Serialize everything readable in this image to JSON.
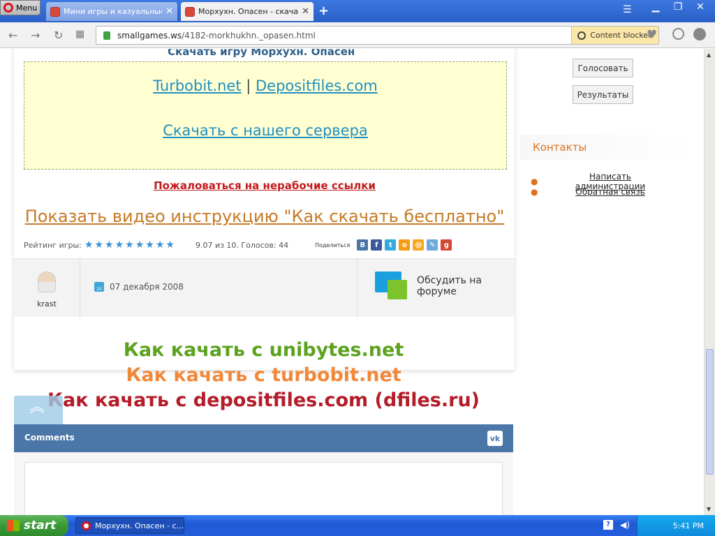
{
  "browser": {
    "menu_label": "Menu",
    "tabs": [
      {
        "title": "Мини игры и казуальные иг",
        "active": false
      },
      {
        "title": "Морхухн. Опасен - скачать",
        "active": true
      }
    ],
    "new_tab_symbol": "+",
    "url_domain": "smallgames.ws",
    "url_path": "/4182-morkhukhn._opasen.html",
    "content_blocked_label": "Content blocked"
  },
  "page": {
    "download_heading": "Скачать игру Морхухн. Опасен",
    "link_turbobit": "Turbobit.net",
    "link_separator": "|",
    "link_depositfiles": "Depositfiles.com",
    "link_own_server": "Скачать с нашего сервера",
    "report_link": "Пожаловаться на нерабочие ссылки",
    "video_link": "Показать видео инструкцию \"Как скачать бесплатно\"",
    "rating_label": "Рейтинг игры:",
    "rating_stars": 9,
    "rating_text": "9.07 из 10. Голосов: 44",
    "share_label": "Поделиться",
    "author": "krast",
    "date": "07 декабря 2008",
    "calendar_day": "20",
    "forum_label_1": "Обсудить на",
    "forum_label_2": "форуме",
    "howto_unibytes": "Как качать с unibytes.net",
    "howto_turbobit": "Как качать с turbobit.net",
    "howto_depositfiles": "Как качать с depositfiles.com (dfiles.ru)",
    "comments_label": "Comments",
    "vk_label": "vk"
  },
  "sidebar": {
    "vote_button": "Голосовать",
    "results_button": "Результаты",
    "contacts_heading": "Контакты",
    "contacts": [
      "Написать администрации",
      "Обратная связь"
    ]
  },
  "taskbar": {
    "start_label": "start",
    "task_title": "Морхухн. Опасен - с...",
    "time": "5:41 PM"
  },
  "colors": {
    "unibytes": "#5ca21e",
    "turbobit": "#f0883a",
    "depositfiles": "#b31c28"
  }
}
